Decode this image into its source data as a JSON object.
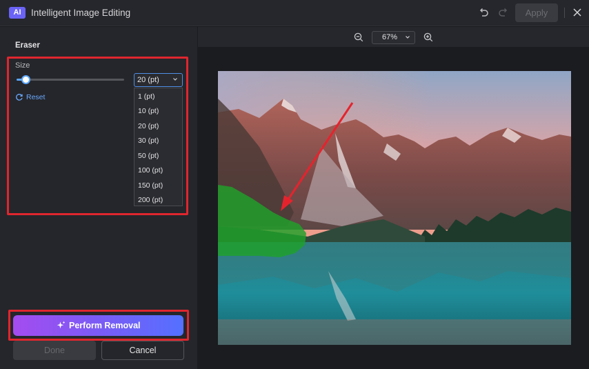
{
  "window": {
    "logo_text": "AI",
    "title": "Intelligent Image Editing",
    "apply_label": "Apply"
  },
  "sidebar": {
    "section_label": "Eraser",
    "size_label": "Size",
    "size_value": "20 (pt)",
    "size_options": [
      "1 (pt)",
      "10 (pt)",
      "20 (pt)",
      "30 (pt)",
      "50 (pt)",
      "100 (pt)",
      "150 (pt)",
      "200 (pt)"
    ],
    "reset_label": "Reset",
    "perform_label": "Perform Removal",
    "done_label": "Done",
    "cancel_label": "Cancel"
  },
  "canvas": {
    "zoom_value": "67%"
  },
  "colors": {
    "accent": "#5aa6ff",
    "highlight": "#e0262e",
    "brand": "#6b63f5"
  }
}
